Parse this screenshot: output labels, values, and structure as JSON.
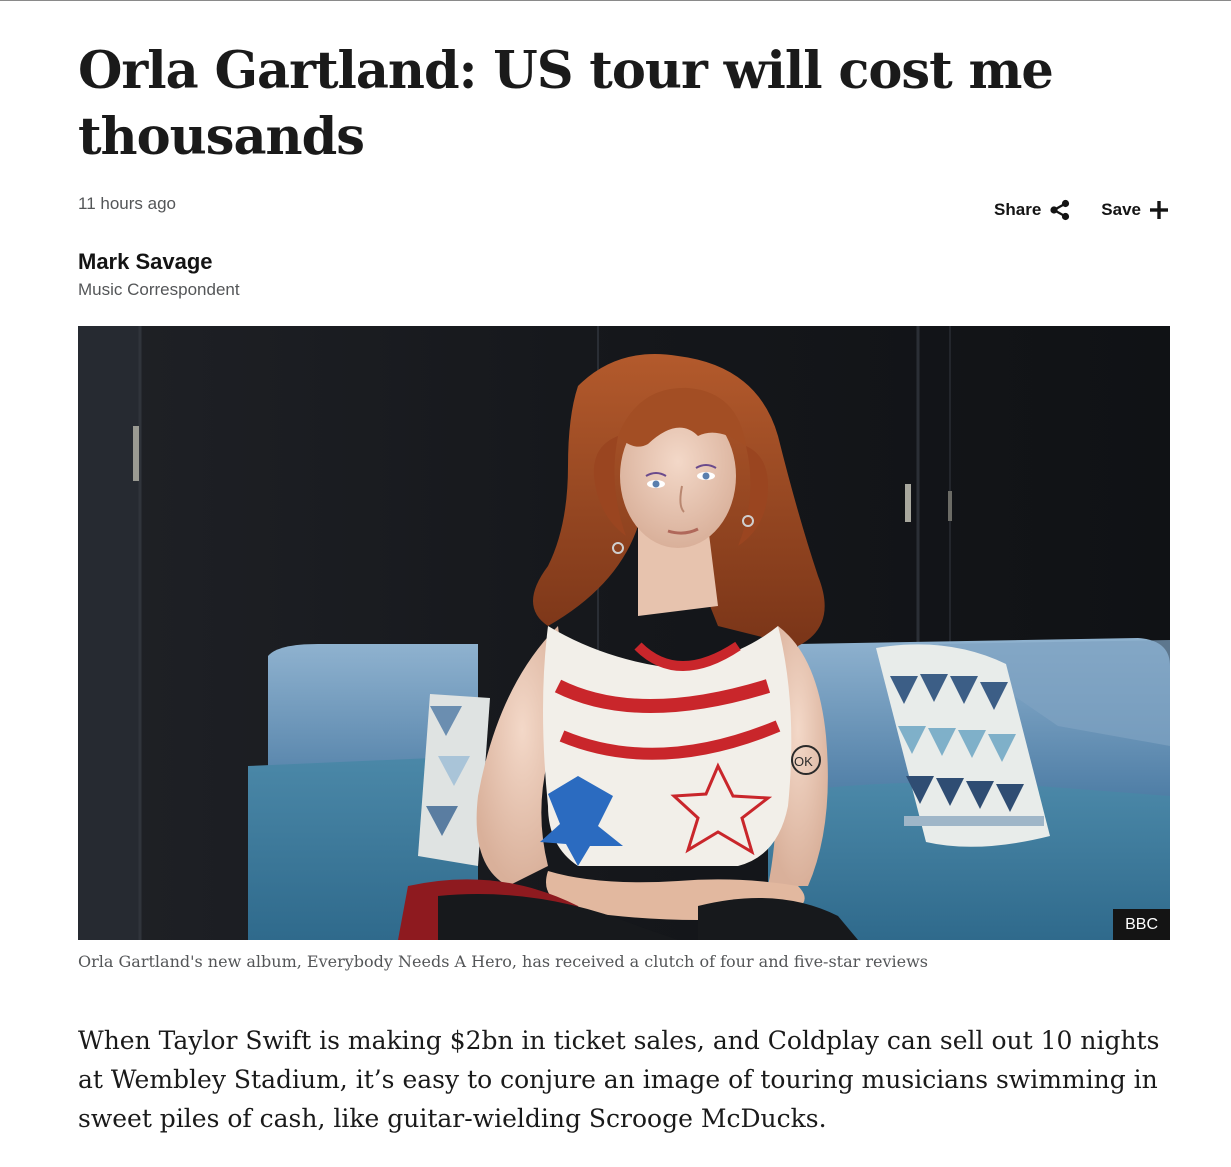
{
  "article": {
    "headline": "Orla Gartland: US tour will cost me thousands",
    "timestamp": "11 hours ago",
    "author": "Mark Savage",
    "author_role": "Music Correspondent"
  },
  "actions": {
    "share_label": "Share",
    "share_icon": "share-icon",
    "save_label": "Save",
    "save_icon": "plus-icon"
  },
  "hero_image": {
    "credit": "BBC",
    "caption": "Orla Gartland's new album, Everybody Needs A Hero, has received a clutch of four and five-star reviews",
    "tattoo_text": "OK"
  },
  "body": {
    "paragraph_1": "When Taylor Swift is making $2bn in ticket sales, and Coldplay can sell out 10 nights at Wembley Stadium, it’s easy to conjure an image of touring musicians swimming in sweet piles of cash, like guitar-wielding Scrooge McDucks."
  },
  "colors": {
    "text_primary": "#141414",
    "text_secondary": "#545658",
    "credit_bg": "#141414"
  }
}
